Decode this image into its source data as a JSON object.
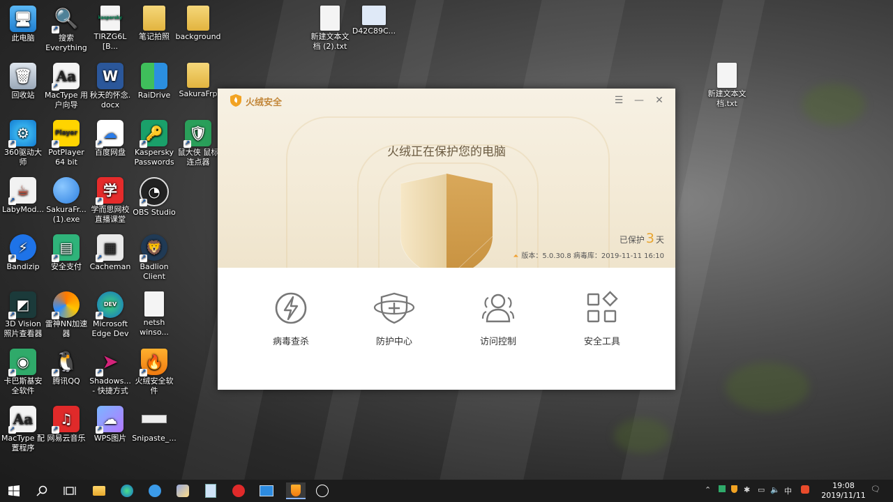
{
  "desktop_icons": [
    {
      "label": "此电脑"
    },
    {
      "label": "搜索\nEverything"
    },
    {
      "label": "TIRZG6L[B..."
    },
    {
      "label": "笔记拍照"
    },
    {
      "label": "background"
    },
    {
      "label": "新建文本文\n档 (2).txt"
    },
    {
      "label": "D42C89C..."
    },
    {
      "label": "回收站"
    },
    {
      "label": "MacType 用\n户向导"
    },
    {
      "label": "秋天的怀念.\ndocx"
    },
    {
      "label": "RaiDrive"
    },
    {
      "label": "SakuraFrp"
    },
    {
      "label": "新建文本文\n档.txt"
    },
    {
      "label": "360驱动大\n师"
    },
    {
      "label": "PotPlayer\n64 bit"
    },
    {
      "label": "百度网盘"
    },
    {
      "label": "Kaspersky\nPasswords"
    },
    {
      "label": "鼠大侠 鼠标\n连点器"
    },
    {
      "label": "LabyMod..."
    },
    {
      "label": "SakuraFr...\n(1).exe"
    },
    {
      "label": "学而思网校\n直播课堂"
    },
    {
      "label": "OBS Studio"
    },
    {
      "label": "Bandizip"
    },
    {
      "label": "安全支付"
    },
    {
      "label": "Cacheman"
    },
    {
      "label": "Badlion\nClient"
    },
    {
      "label": "3D Vision\n照片查看器"
    },
    {
      "label": "雷神NN加速\n器"
    },
    {
      "label": "Microsoft\nEdge Dev"
    },
    {
      "label": "netsh\nwinso..."
    },
    {
      "label": "卡巴斯基安\n全软件"
    },
    {
      "label": "腾讯QQ"
    },
    {
      "label": "Shadows...\n- 快捷方式"
    },
    {
      "label": "火绒安全软\n件"
    },
    {
      "label": "MacType 配\n置程序"
    },
    {
      "label": "网易云音乐"
    },
    {
      "label": "WPS图片"
    },
    {
      "label": "Snipaste_..."
    }
  ],
  "icon_glyphs": {
    "kaspersky_text": "kaspersky",
    "potplayer_text": "Player",
    "xueersi_text": "学",
    "edge_dev_text": "DEV",
    "mactype_text": "Aa"
  },
  "app": {
    "name": "火绒安全",
    "headline": "火绒正在保护您的电脑",
    "protected_prefix": "已保护",
    "protected_days": "3",
    "protected_suffix": "天",
    "version_text": "版本：5.0.30.8  病毒库：2019-11-11 16:10",
    "tools": [
      {
        "label": "病毒查杀",
        "icon": "lightning-circle-icon"
      },
      {
        "label": "防护中心",
        "icon": "shield-plus-icon"
      },
      {
        "label": "访问控制",
        "icon": "users-icon"
      },
      {
        "label": "安全工具",
        "icon": "apps-grid-icon"
      }
    ],
    "accent": "#c2873a",
    "gold": "#e8a530"
  },
  "taskbar": {
    "ime": "中",
    "time": "19:08",
    "date": "2019/11/11"
  }
}
